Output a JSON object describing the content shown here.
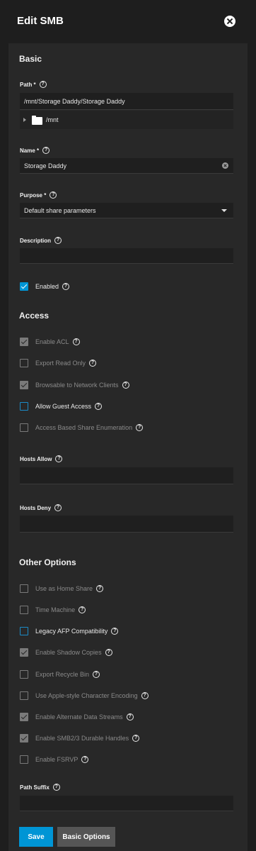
{
  "header": {
    "title": "Edit SMB"
  },
  "basic": {
    "section_title": "Basic",
    "path_label": "Path *",
    "path_value": "/mnt/Storage Daddy/Storage Daddy",
    "tree_root": "/mnt",
    "name_label": "Name *",
    "name_value": "Storage Daddy",
    "purpose_label": "Purpose *",
    "purpose_value": "Default share parameters",
    "description_label": "Description",
    "description_value": "",
    "enabled_label": "Enabled"
  },
  "access": {
    "section_title": "Access",
    "items": [
      {
        "label": "Enable ACL",
        "checked": true,
        "disabled": true
      },
      {
        "label": "Export Read Only",
        "checked": false,
        "disabled": true
      },
      {
        "label": "Browsable to Network Clients",
        "checked": true,
        "disabled": true
      },
      {
        "label": "Allow Guest Access",
        "checked": false,
        "disabled": false
      },
      {
        "label": "Access Based Share Enumeration",
        "checked": false,
        "disabled": true
      }
    ],
    "hosts_allow_label": "Hosts Allow",
    "hosts_deny_label": "Hosts Deny"
  },
  "other": {
    "section_title": "Other Options",
    "items": [
      {
        "label": "Use as Home Share",
        "checked": false,
        "disabled": true
      },
      {
        "label": "Time Machine",
        "checked": false,
        "disabled": true
      },
      {
        "label": "Legacy AFP Compatibility",
        "checked": false,
        "disabled": false
      },
      {
        "label": "Enable Shadow Copies",
        "checked": true,
        "disabled": true
      },
      {
        "label": "Export Recycle Bin",
        "checked": false,
        "disabled": true
      },
      {
        "label": "Use Apple-style Character Encoding",
        "checked": false,
        "disabled": true
      },
      {
        "label": "Enable Alternate Data Streams",
        "checked": true,
        "disabled": true
      },
      {
        "label": "Enable SMB2/3 Durable Handles",
        "checked": true,
        "disabled": true
      },
      {
        "label": "Enable FSRVP",
        "checked": false,
        "disabled": true
      }
    ],
    "path_suffix_label": "Path Suffix"
  },
  "buttons": {
    "save": "Save",
    "basic_options": "Basic Options"
  },
  "colors": {
    "accent": "#0095d5",
    "background": "#1e1e1e",
    "panel": "#282828"
  }
}
